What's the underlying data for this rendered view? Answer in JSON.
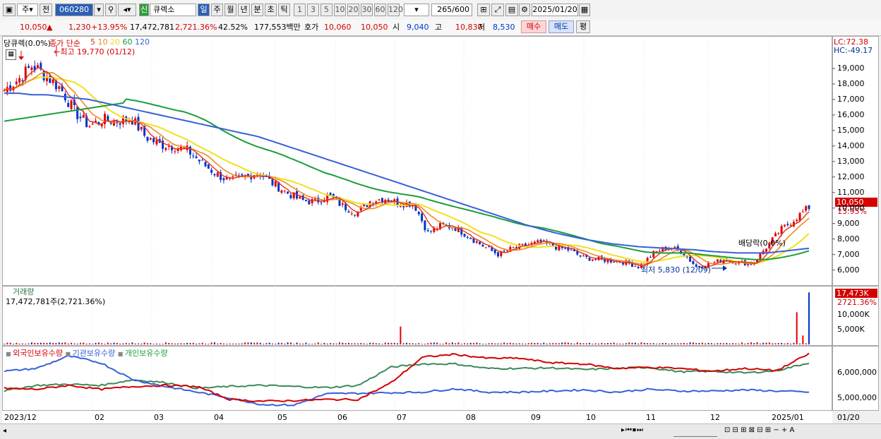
{
  "toolbar": {
    "period_label": "주",
    "prev_label": "전",
    "code": "060280",
    "new_badge": "신",
    "stock_name": "큐렉소",
    "tabs": [
      "일",
      "주",
      "월",
      "년",
      "분",
      "초",
      "틱"
    ],
    "numbers": [
      "1",
      "3",
      "5",
      "10",
      "20",
      "30",
      "60",
      "120"
    ],
    "count": "265",
    "count_total": "/600",
    "date": "2025/01/20"
  },
  "info": {
    "price": "10,050",
    "arrow": "▲",
    "change": "1,230",
    "change_pct": "+13.95%",
    "volume": "17,472,781",
    "volume_ratio": "2,721.36%",
    "turnover": "42.52%",
    "amount": "177,553백만",
    "bid_label": "호가",
    "bid1": "10,060",
    "bid2": "10,050",
    "open_label": "시",
    "open": "9,040",
    "high_label": "고",
    "high": "10,830",
    "low_label": "저",
    "low": "8,530",
    "buy_label": "매수",
    "sell_label": "매도",
    "eval_label": "평"
  },
  "price_panel": {
    "legend_title": "당큐렉(0.0%)",
    "legend_ma": "종가 단순",
    "ma_periods": [
      "5",
      "10",
      "20",
      "60",
      "120"
    ],
    "high_note": "←최고 19,770 (01/12)",
    "low_note": "최저 5,830 (12/09)",
    "div_note": "배당락(0.0%)",
    "lc": "LC:72.38",
    "hc": "HC:-49.17",
    "current_price": "10,050",
    "current_pct": "13.95%"
  },
  "volume_panel": {
    "title": "거래량",
    "value": "17,472,781주(2,721.36%)",
    "current": "17,473K",
    "current_pct": "2721.36%"
  },
  "holding_panel": {
    "series": [
      "외국인보유수량",
      "기관보유수량",
      "개인보유수량"
    ]
  },
  "colors": {
    "up": "#e00000",
    "down": "#0033cc",
    "ma5": "#e03020",
    "ma10": "#f08a1c",
    "ma20": "#f0e020",
    "ma60": "#1a9e3a",
    "ma120": "#3860d8"
  },
  "chart_data": [
    {
      "type": "line",
      "title": "",
      "x_ticks": [
        "2023/12",
        "02",
        "03",
        "04",
        "05",
        "06",
        "07",
        "08",
        "09",
        "10",
        "11",
        "12",
        "2025/01",
        "01/20"
      ],
      "y_ticks": [
        "19,000",
        "18,000",
        "17,000",
        "16,000",
        "15,000",
        "14,000",
        "13,000",
        "12,000",
        "11,000",
        "10,000",
        "9,000",
        "8,000",
        "7,000",
        "6,000"
      ],
      "ylim": [
        5300,
        20500
      ],
      "series": [
        {
          "name": "종가",
          "values": [
            17600,
            18300,
            19200,
            18500,
            17700,
            16200,
            15300,
            15700,
            15600,
            15800,
            14600,
            14100,
            14000,
            13700,
            12900,
            12200,
            11700,
            12000,
            12300,
            11600,
            11000,
            10500,
            10400,
            10800,
            10100,
            9700,
            10500,
            10600,
            10300,
            10300,
            8400,
            8900,
            8700,
            8100,
            7500,
            7000,
            7400,
            7600,
            7800,
            7500,
            7300,
            6800,
            6700,
            6600,
            6500,
            6200,
            7100,
            7500,
            7200,
            6200,
            6400,
            6700,
            6500,
            6400,
            7500,
            8600,
            9300,
            10050
          ]
        },
        {
          "name": "120",
          "values": [
            17400,
            17400,
            17300,
            17300,
            17200,
            17100,
            17000,
            16800,
            16600,
            16400,
            16200,
            16000,
            15800,
            15600,
            15400,
            15200,
            15000,
            14800,
            14600,
            14300,
            14000,
            13700,
            13400,
            13100,
            12800,
            12500,
            12200,
            11900,
            11600,
            11300,
            11000,
            10700,
            10400,
            10100,
            9800,
            9500,
            9200,
            8900,
            8650,
            8400,
            8200,
            8000,
            7850,
            7700,
            7600,
            7500,
            7450,
            7400,
            7350,
            7300,
            7200,
            7150,
            7100,
            7100,
            7100,
            7200,
            7300,
            7400
          ]
        }
      ]
    },
    {
      "type": "bar",
      "title": "거래량",
      "y_ticks": [
        "10,000K",
        "5,000K"
      ],
      "current": 17473
    },
    {
      "type": "line",
      "title": "",
      "y_ticks": [
        "6,000,000",
        "5,000,000"
      ],
      "series": [
        {
          "name": "외국인보유수량"
        },
        {
          "name": "기관보유수량"
        },
        {
          "name": "개인보유수량"
        }
      ]
    }
  ]
}
